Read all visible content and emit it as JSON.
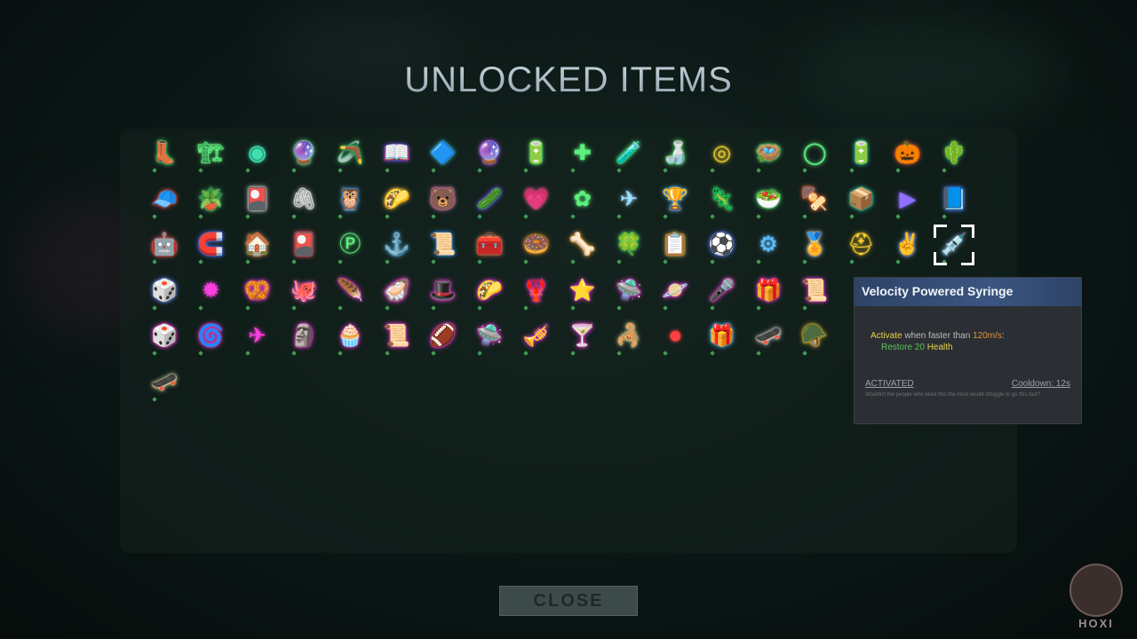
{
  "screen": {
    "title": "UNLOCKED ITEMS"
  },
  "icons": [
    {
      "g": "👢",
      "c": "#4fe07a"
    },
    {
      "g": "🏗",
      "c": "#5ef07e"
    },
    {
      "g": "◉",
      "c": "#3fe0b0"
    },
    {
      "g": "🔮",
      "c": "#7ef0a0"
    },
    {
      "g": "🪃",
      "c": "#4fe07a"
    },
    {
      "g": "📖",
      "c": "#7f5bff"
    },
    {
      "g": "🔷",
      "c": "#3fc0e0"
    },
    {
      "g": "🔮",
      "c": "#c060ff"
    },
    {
      "g": "🔋",
      "c": "#5ef07e"
    },
    {
      "g": "✚",
      "c": "#5ef07e"
    },
    {
      "g": "🧪",
      "c": "#5ef07e"
    },
    {
      "g": "🍶",
      "c": "#5ef07e"
    },
    {
      "g": "◎",
      "c": "#e0c030"
    },
    {
      "g": "🪺",
      "c": "#5ef07e"
    },
    {
      "g": "◯",
      "c": "#5ef07e"
    },
    {
      "g": "🔋",
      "c": "#3fe0b0"
    },
    {
      "g": "🎃",
      "c": "#ff6a3a"
    },
    {
      "g": "🌵",
      "c": "#5ef07e"
    },
    {
      "g": "🧢",
      "c": "#ff5a5a"
    },
    {
      "g": "🪴",
      "c": "#5ef07e"
    },
    {
      "g": "🎴",
      "c": "#e0e0e0"
    },
    {
      "g": "🖇",
      "c": "#e0e0e0"
    },
    {
      "g": "🦉",
      "c": "#60b0ff"
    },
    {
      "g": "🌮",
      "c": "#ffc040"
    },
    {
      "g": "🐻",
      "c": "#ff8ac0"
    },
    {
      "g": "🥒",
      "c": "#8060ff"
    },
    {
      "g": "💗",
      "c": "#ff6aa0"
    },
    {
      "g": "✿",
      "c": "#5ef07e"
    },
    {
      "g": "✈",
      "c": "#a0e0ff"
    },
    {
      "g": "🏆",
      "c": "#60c0ff"
    },
    {
      "g": "🦎",
      "c": "#5ef07e"
    },
    {
      "g": "🥗",
      "c": "#5ef07e"
    },
    {
      "g": "🍢",
      "c": "#ff7a4a"
    },
    {
      "g": "📦",
      "c": "#3fe0b0"
    },
    {
      "g": "▶",
      "c": "#9070ff"
    },
    {
      "g": "📘",
      "c": "#5080ff"
    },
    {
      "g": "🤖",
      "c": "#ff6a6a"
    },
    {
      "g": "🧲",
      "c": "#5a7aff"
    },
    {
      "g": "🏠",
      "c": "#ffb070"
    },
    {
      "g": "🎴",
      "c": "#ff5a70"
    },
    {
      "g": "Ⓟ",
      "c": "#5ef07e"
    },
    {
      "g": "⚓",
      "c": "#60c0ff"
    },
    {
      "g": "📜",
      "c": "#3fa0ff"
    },
    {
      "g": "🧰",
      "c": "#ff8a5a"
    },
    {
      "g": "🍩",
      "c": "#ffa030"
    },
    {
      "g": "🦴",
      "c": "#ffb040"
    },
    {
      "g": "🍀",
      "c": "#5ef07e"
    },
    {
      "g": "📋",
      "c": "#ffd060"
    },
    {
      "g": "⚽",
      "c": "#5a7aff"
    },
    {
      "g": "⚙",
      "c": "#60c0ff"
    },
    {
      "g": "🏅",
      "c": "#e0e0e0"
    },
    {
      "g": "⛑",
      "c": "#ffd030"
    },
    {
      "g": "✌",
      "c": "#a0c0ff"
    },
    {
      "g": "💉",
      "c": "#a0d0ff"
    },
    {
      "g": "🎲",
      "c": "#7090ff"
    },
    {
      "g": "✹",
      "c": "#ff40e0"
    },
    {
      "g": "🥨",
      "c": "#ff40e0"
    },
    {
      "g": "🐙",
      "c": "#ff60e0"
    },
    {
      "g": "🪶",
      "c": "#ff40e0"
    },
    {
      "g": "🦪",
      "c": "#ff40e0"
    },
    {
      "g": "🎩",
      "c": "#ff40e0"
    },
    {
      "g": "🌮",
      "c": "#ff40e0"
    },
    {
      "g": "🦞",
      "c": "#ff40e0"
    },
    {
      "g": "⭐",
      "c": "#ff40e0"
    },
    {
      "g": "🛸",
      "c": "#ff40e0"
    },
    {
      "g": "🪐",
      "c": "#ff40e0"
    },
    {
      "g": "🎤",
      "c": "#ff40e0"
    },
    {
      "g": "🎁",
      "c": "#ff40e0"
    },
    {
      "g": "📜",
      "c": "#ff40e0"
    },
    {
      "g": "🎲",
      "c": "#ff40e0"
    },
    {
      "g": "🌀",
      "c": "#ff40e0"
    },
    {
      "g": "✈",
      "c": "#ff40e0"
    },
    {
      "g": "🗿",
      "c": "#ff40e0"
    },
    {
      "g": "🧁",
      "c": "#ff40e0"
    },
    {
      "g": "📜",
      "c": "#ff40e0"
    },
    {
      "g": "🏈",
      "c": "#ff40e0"
    },
    {
      "g": "🛸",
      "c": "#ff40e0"
    },
    {
      "g": "🎺",
      "c": "#ff40e0"
    },
    {
      "g": "🍸",
      "c": "#ff40e0"
    },
    {
      "g": "🦂",
      "c": "#e0e0a0"
    },
    {
      "g": "⏺",
      "c": "#ff4040"
    },
    {
      "g": "🎁",
      "c": "#60c0ff"
    },
    {
      "g": "🛹",
      "c": "#e0e0e0"
    },
    {
      "g": "🪖",
      "c": "#ffd030"
    },
    {
      "g": "🛹",
      "c": "#e0e0a0"
    }
  ],
  "tooltip": {
    "title": "Velocity Powered Syringe",
    "activate_word": "Activate",
    "condition_text": " when faster than ",
    "speed": "120m/s",
    "colon": ":",
    "restore_text": "Restore 20",
    "health_text": " Health",
    "status": "ACTIVATED",
    "cooldown": "Cooldown: 12s",
    "flavor": "Wouldn't the people who need this the most would struggle to go this fast?"
  },
  "buttons": {
    "close": "CLOSE"
  },
  "watermark": {
    "text": "HOXI"
  }
}
